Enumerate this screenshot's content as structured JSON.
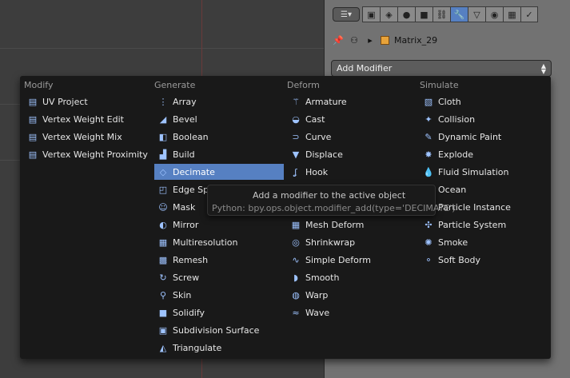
{
  "properties": {
    "editor_type_icon": "properties-editor-icon",
    "tabs": [
      {
        "icon": "render-icon",
        "glyph": "▣"
      },
      {
        "icon": "scene-icon",
        "glyph": "◈"
      },
      {
        "icon": "world-icon",
        "glyph": "●"
      },
      {
        "icon": "object-icon",
        "glyph": "■"
      },
      {
        "icon": "constraints-icon",
        "glyph": "⛓"
      },
      {
        "icon": "modifiers-wrench-icon",
        "glyph": "🔧",
        "active": true
      },
      {
        "icon": "data-icon",
        "glyph": "▽"
      },
      {
        "icon": "material-icon",
        "glyph": "◉"
      },
      {
        "icon": "texture-icon",
        "glyph": "▦"
      },
      {
        "icon": "physics-icon",
        "glyph": "✓"
      }
    ],
    "breadcrumb_object": "Matrix_29",
    "add_modifier_label": "Add Modifier"
  },
  "menu": {
    "columns": [
      {
        "heading": "Modify",
        "items": [
          {
            "label": "UV Project",
            "icon": "uv-project-icon",
            "glyph": "▤"
          },
          {
            "label": "Vertex Weight Edit",
            "icon": "vertex-weight-icon",
            "glyph": "▤"
          },
          {
            "label": "Vertex Weight Mix",
            "icon": "vertex-weight-icon",
            "glyph": "▤"
          },
          {
            "label": "Vertex Weight Proximity",
            "icon": "vertex-weight-icon",
            "glyph": "▤"
          }
        ]
      },
      {
        "heading": "Generate",
        "items": [
          {
            "label": "Array",
            "icon": "array-icon",
            "glyph": "⋮"
          },
          {
            "label": "Bevel",
            "icon": "bevel-icon",
            "glyph": "◢"
          },
          {
            "label": "Boolean",
            "icon": "boolean-icon",
            "glyph": "◧"
          },
          {
            "label": "Build",
            "icon": "build-icon",
            "glyph": "▟"
          },
          {
            "label": "Decimate",
            "icon": "decimate-icon",
            "glyph": "◇",
            "highlighted": true
          },
          {
            "label": "Edge Split",
            "icon": "edge-split-icon",
            "glyph": "◰"
          },
          {
            "label": "Mask",
            "icon": "mask-icon",
            "glyph": "☺"
          },
          {
            "label": "Mirror",
            "icon": "mirror-icon",
            "glyph": "◐"
          },
          {
            "label": "Multiresolution",
            "icon": "multires-icon",
            "glyph": "▦"
          },
          {
            "label": "Remesh",
            "icon": "remesh-icon",
            "glyph": "▩"
          },
          {
            "label": "Screw",
            "icon": "screw-icon",
            "glyph": "↻"
          },
          {
            "label": "Skin",
            "icon": "skin-icon",
            "glyph": "⚲"
          },
          {
            "label": "Solidify",
            "icon": "solidify-icon",
            "glyph": "■"
          },
          {
            "label": "Subdivision Surface",
            "icon": "subsurf-icon",
            "glyph": "▣"
          },
          {
            "label": "Triangulate",
            "icon": "triangulate-icon",
            "glyph": "◭"
          }
        ]
      },
      {
        "heading": "Deform",
        "items": [
          {
            "label": "Armature",
            "icon": "armature-icon",
            "glyph": "⚚"
          },
          {
            "label": "Cast",
            "icon": "cast-icon",
            "glyph": "◒"
          },
          {
            "label": "Curve",
            "icon": "curve-icon",
            "glyph": "⊃"
          },
          {
            "label": "Displace",
            "icon": "displace-icon",
            "glyph": "▼"
          },
          {
            "label": "Hook",
            "icon": "hook-icon",
            "glyph": "ʆ"
          },
          {
            "label": "",
            "icon": "",
            "glyph": ""
          },
          {
            "label": "",
            "icon": "",
            "glyph": ""
          },
          {
            "label": "Mesh Deform",
            "icon": "mesh-deform-icon",
            "glyph": "▦"
          },
          {
            "label": "Shrinkwrap",
            "icon": "shrinkwrap-icon",
            "glyph": "◎"
          },
          {
            "label": "Simple Deform",
            "icon": "simple-deform-icon",
            "glyph": "∿"
          },
          {
            "label": "Smooth",
            "icon": "smooth-icon",
            "glyph": "◗"
          },
          {
            "label": "Warp",
            "icon": "warp-icon",
            "glyph": "◍"
          },
          {
            "label": "Wave",
            "icon": "wave-icon",
            "glyph": "≈"
          }
        ]
      },
      {
        "heading": "Simulate",
        "items": [
          {
            "label": "Cloth",
            "icon": "cloth-icon",
            "glyph": "▧"
          },
          {
            "label": "Collision",
            "icon": "collision-icon",
            "glyph": "✦"
          },
          {
            "label": "Dynamic Paint",
            "icon": "dynamic-paint-icon",
            "glyph": "✎"
          },
          {
            "label": "Explode",
            "icon": "explode-icon",
            "glyph": "✸"
          },
          {
            "label": "Fluid Simulation",
            "icon": "fluid-icon",
            "glyph": "💧"
          },
          {
            "label": "Ocean",
            "icon": "ocean-icon",
            "glyph": "≋"
          },
          {
            "label": "Particle Instance",
            "icon": "particle-instance-icon",
            "glyph": "⁂"
          },
          {
            "label": "Particle System",
            "icon": "particle-system-icon",
            "glyph": "✣"
          },
          {
            "label": "Smoke",
            "icon": "smoke-icon",
            "glyph": "✺"
          },
          {
            "label": "Soft Body",
            "icon": "soft-body-icon",
            "glyph": "⚬"
          }
        ]
      }
    ]
  },
  "tooltip": {
    "description": "Add a modifier to the active object",
    "python": "Python: bpy.ops.object.modifier_add(type='DECIMATE')"
  }
}
